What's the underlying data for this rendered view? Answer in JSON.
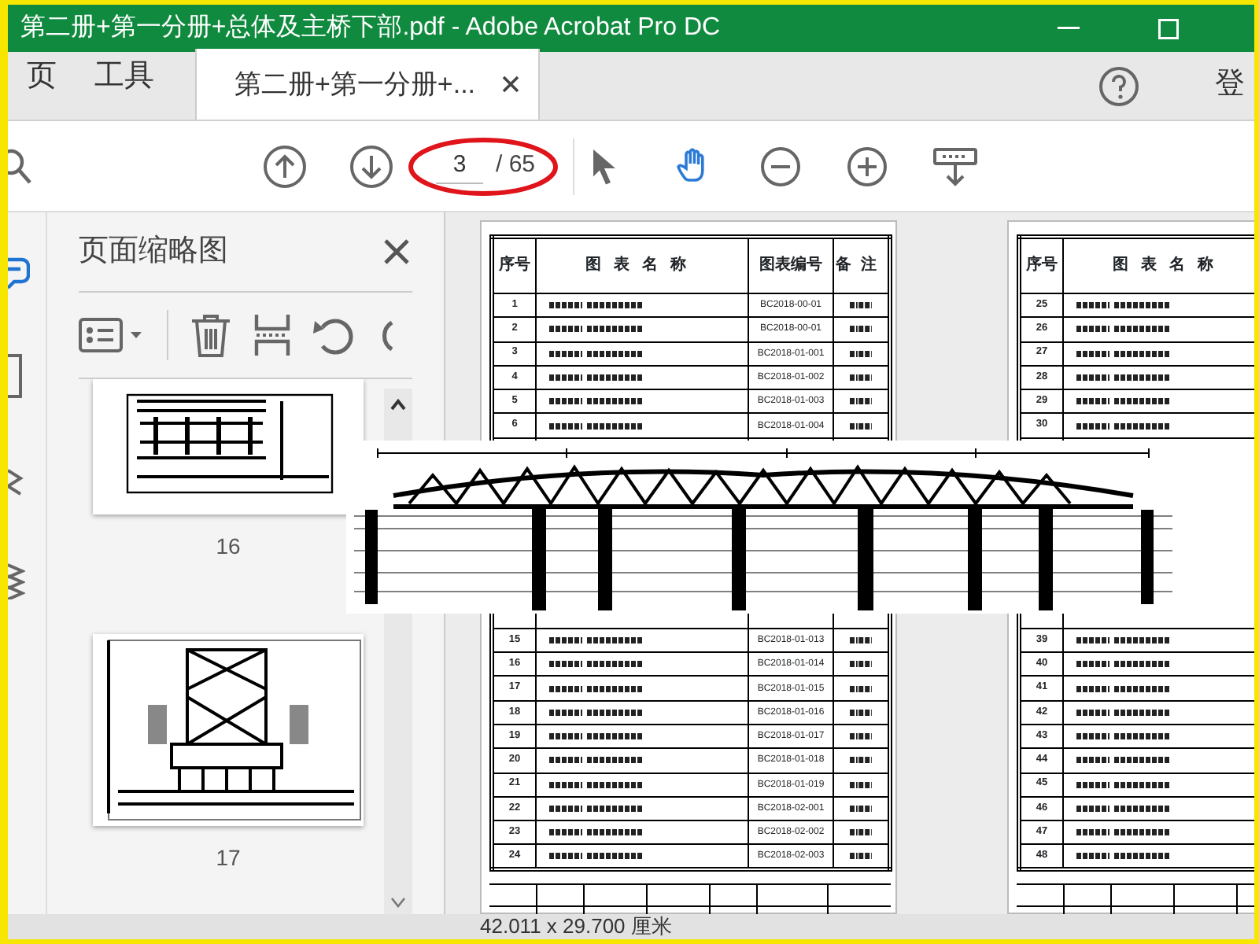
{
  "window": {
    "title": "第二册+第一分册+总体及主桥下部.pdf - Adobe Acrobat Pro DC"
  },
  "tabs": [
    {
      "label": "页",
      "selected": false
    },
    {
      "label": "工具",
      "selected": false
    },
    {
      "label": "第二册+第一分册+...",
      "selected": true
    }
  ],
  "account": {
    "label": "登"
  },
  "toolbar": {
    "page_field": {
      "value": "3",
      "total": "/ 65"
    },
    "tools": [
      {
        "kind": "pointer",
        "selected": false
      },
      {
        "kind": "hand",
        "selected": true
      },
      {
        "kind": "zoom-out",
        "selected": false
      },
      {
        "kind": "zoom-in",
        "selected": false
      },
      {
        "kind": "scroll-mode",
        "selected": false
      }
    ]
  },
  "sidebar": {
    "title": "页面缩略图",
    "thumbnails": [
      {
        "label": "16",
        "kind": "plan"
      },
      {
        "label": "17",
        "kind": "elevation"
      }
    ]
  },
  "document": {
    "pages": [
      {
        "headers": [
          "序号",
          "图表名称",
          "图表编号",
          "备注"
        ],
        "rows_top": [
          {
            "number": "1",
            "code": "BC2018-00-01"
          },
          {
            "number": "2",
            "code": "BC2018-00-01"
          },
          {
            "number": "3",
            "code": "BC2018-01-001"
          },
          {
            "number": "4",
            "code": "BC2018-01-002"
          },
          {
            "number": "5",
            "code": "BC2018-01-003"
          },
          {
            "number": "6",
            "code": "BC2018-01-004"
          }
        ],
        "rows_bottom": [
          {
            "number": "15",
            "code": "BC2018-01-013"
          },
          {
            "number": "16",
            "code": "BC2018-01-014"
          },
          {
            "number": "17",
            "code": "BC2018-01-015"
          },
          {
            "number": "18",
            "code": "BC2018-01-016"
          },
          {
            "number": "19",
            "code": "BC2018-01-017"
          },
          {
            "number": "20",
            "code": "BC2018-01-018"
          },
          {
            "number": "21",
            "code": "BC2018-01-019"
          },
          {
            "number": "22",
            "code": "BC2018-02-001"
          },
          {
            "number": "23",
            "code": "BC2018-02-002"
          },
          {
            "number": "24",
            "code": "BC2018-02-003"
          }
        ]
      },
      {
        "headers": [
          "序号",
          "图表名称"
        ],
        "rows_top": [
          {
            "number": "25"
          },
          {
            "number": "26"
          },
          {
            "number": "27"
          },
          {
            "number": "28"
          },
          {
            "number": "29"
          },
          {
            "number": "30"
          }
        ],
        "rows_bottom": [
          {
            "number": "39"
          },
          {
            "number": "40"
          },
          {
            "number": "41"
          },
          {
            "number": "42"
          },
          {
            "number": "43"
          },
          {
            "number": "44"
          },
          {
            "number": "45"
          },
          {
            "number": "46"
          },
          {
            "number": "47"
          },
          {
            "number": "48"
          }
        ]
      }
    ]
  },
  "status_bar": {
    "page_size": "42.011 x 29.700 厘米"
  }
}
